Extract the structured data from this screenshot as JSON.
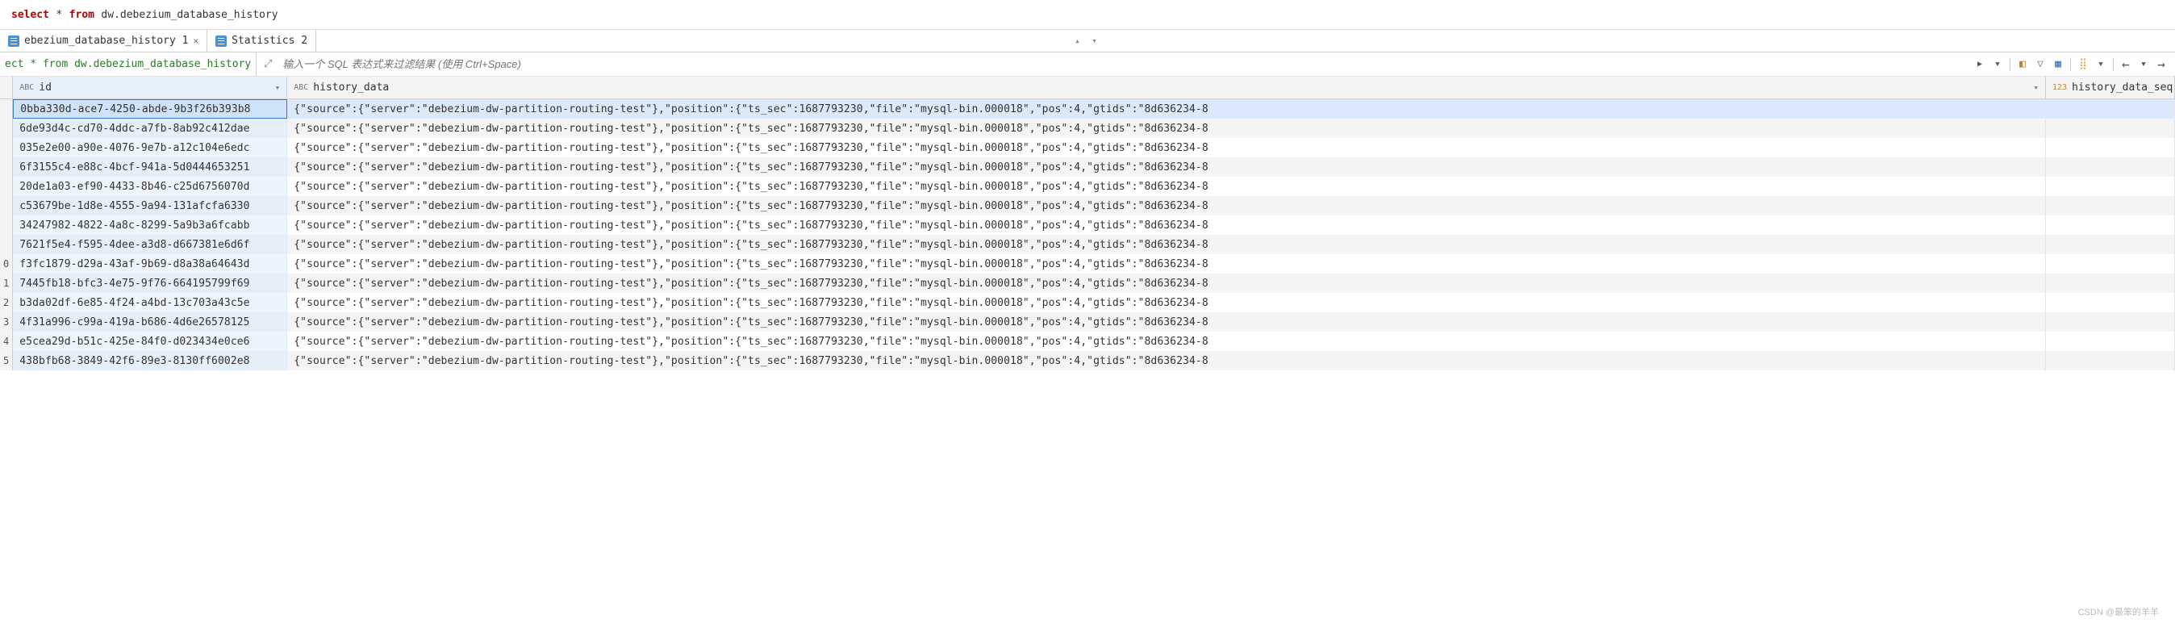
{
  "editor": {
    "kw_select": "select",
    "star": "*",
    "kw_from": "from",
    "table": "dw.debezium_database_history"
  },
  "tabs": [
    {
      "label": "ebezium_database_history 1",
      "closable": true
    },
    {
      "label": "Statistics 2",
      "closable": false
    }
  ],
  "crumb": "ect * from dw.debezium_database_history",
  "filter_placeholder": "输入一个 SQL 表达式来过滤结果 (使用 Ctrl+Space)",
  "columns": {
    "id": {
      "type": "ABC",
      "label": "id"
    },
    "history_data": {
      "type": "ABC",
      "label": "history_data"
    },
    "history_data_seq": {
      "type": "123",
      "label": "history_data_seq"
    }
  },
  "funnel_glyph": "▾",
  "hd_value": "{\"source\":{\"server\":\"debezium-dw-partition-routing-test\"},\"position\":{\"ts_sec\":1687793230,\"file\":\"mysql-bin.000018\",\"pos\":4,\"gtids\":\"8d636234-8",
  "rows": [
    {
      "n": "",
      "id": "0bba330d-ace7-4250-abde-9b3f26b393b8"
    },
    {
      "n": "",
      "id": "6de93d4c-cd70-4ddc-a7fb-8ab92c412dae"
    },
    {
      "n": "",
      "id": "035e2e00-a90e-4076-9e7b-a12c104e6edc"
    },
    {
      "n": "",
      "id": "6f3155c4-e88c-4bcf-941a-5d0444653251"
    },
    {
      "n": "",
      "id": "20de1a03-ef90-4433-8b46-c25d6756070d"
    },
    {
      "n": "",
      "id": "c53679be-1d8e-4555-9a94-131afcfa6330"
    },
    {
      "n": "",
      "id": "34247982-4822-4a8c-8299-5a9b3a6fcabb"
    },
    {
      "n": "",
      "id": "7621f5e4-f595-4dee-a3d8-d667381e6d6f"
    },
    {
      "n": "0",
      "id": "f3fc1879-d29a-43af-9b69-d8a38a64643d"
    },
    {
      "n": "1",
      "id": "7445fb18-bfc3-4e75-9f76-664195799f69"
    },
    {
      "n": "2",
      "id": "b3da02df-6e85-4f24-a4bd-13c703a43c5e"
    },
    {
      "n": "3",
      "id": "4f31a996-c99a-419a-b686-4d6e26578125"
    },
    {
      "n": "4",
      "id": "e5cea29d-b51c-425e-84f0-d023434e0ce6"
    },
    {
      "n": "5",
      "id": "438bfb68-3849-42f6-89e3-8130ff6002e8"
    }
  ],
  "watermark": "CSDN @最笨的羊羊"
}
